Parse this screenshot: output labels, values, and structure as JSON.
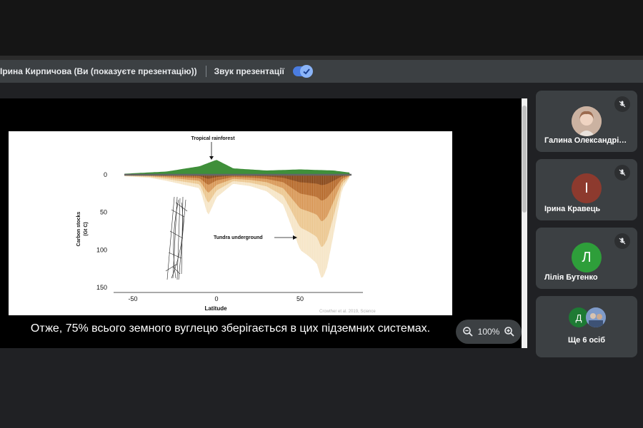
{
  "infobar": {
    "presenter": "Ірина Кирпичова (Ви (показуєте презентацію))",
    "audio_label": "Звук презентації"
  },
  "slide": {
    "caption": "Отже, 75% всього земного вуглецю зберігається в цих підземних системах.",
    "figure": {
      "ylabel": "Carbon stocks (Gt C)",
      "ylabel_line1": "Carbon stocks",
      "ylabel_line2": "(Gt C)",
      "xlabel": "Latitude",
      "yticks": [
        "0",
        "50",
        "100",
        "150"
      ],
      "xticks": [
        "-50",
        "0",
        "50"
      ],
      "annotation_top": "Tropical rainforest",
      "annotation_right": "Tundra underground",
      "credit": "Crowther et al. 2019, Science"
    }
  },
  "zoom": {
    "level": "100%"
  },
  "participants": [
    {
      "name": "Галина Олександрівна",
      "display": "Галина Олександрівн…",
      "initial": "",
      "color": "#d9b9a6",
      "muted": true
    },
    {
      "name": "Ірина Кравець",
      "initial": "І",
      "color": "#8d3a2e",
      "muted": true
    },
    {
      "name": "Лілія Бутенко",
      "initial": "Л",
      "color": "#2e9e3a",
      "muted": true
    }
  ],
  "more": {
    "label": "Ще 6 осіб",
    "initial": "Д",
    "initial_color": "#1e7a34"
  },
  "chart_data": {
    "type": "area",
    "title": "",
    "xlabel": "Latitude",
    "ylabel": "Carbon stocks (Gt C)",
    "xlim": [
      -55,
      80
    ],
    "ylim": [
      0,
      150
    ],
    "annotations": [
      "Tropical rainforest",
      "Tundra underground"
    ],
    "series": [
      {
        "name": "",
        "note": "aboveground (plotted upward)",
        "x": [
          -55,
          -30,
          -10,
          0,
          10,
          30,
          50,
          70,
          80
        ],
        "values": [
          1,
          3,
          8,
          14,
          6,
          4,
          5,
          4,
          2
        ]
      },
      {
        "name": "",
        "note": "underground total",
        "x": [
          -55,
          -40,
          -30,
          -10,
          -5,
          0,
          10,
          20,
          30,
          40,
          45,
          50,
          55,
          60,
          63,
          66,
          70,
          75,
          80
        ],
        "values": [
          2,
          4,
          8,
          18,
          55,
          30,
          12,
          15,
          22,
          40,
          70,
          100,
          108,
          118,
          140,
          125,
          80,
          20,
          2
        ]
      }
    ]
  }
}
